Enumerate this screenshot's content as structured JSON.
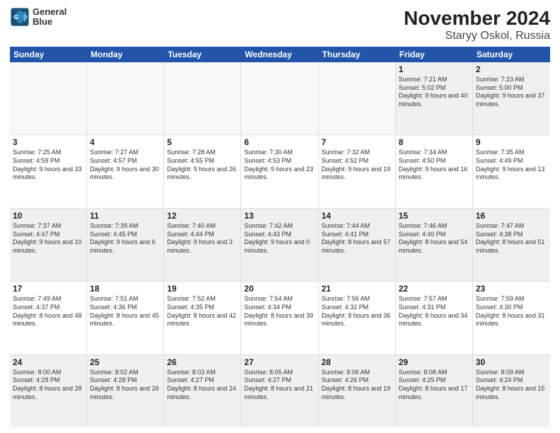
{
  "header": {
    "logo_line1": "General",
    "logo_line2": "Blue",
    "title": "November 2024",
    "subtitle": "Staryy Oskol, Russia"
  },
  "weekdays": [
    "Sunday",
    "Monday",
    "Tuesday",
    "Wednesday",
    "Thursday",
    "Friday",
    "Saturday"
  ],
  "rows": [
    [
      {
        "day": "",
        "info": ""
      },
      {
        "day": "",
        "info": ""
      },
      {
        "day": "",
        "info": ""
      },
      {
        "day": "",
        "info": ""
      },
      {
        "day": "",
        "info": ""
      },
      {
        "day": "1",
        "info": "Sunrise: 7:21 AM\nSunset: 5:02 PM\nDaylight: 9 hours and 40 minutes."
      },
      {
        "day": "2",
        "info": "Sunrise: 7:23 AM\nSunset: 5:00 PM\nDaylight: 9 hours and 37 minutes."
      }
    ],
    [
      {
        "day": "3",
        "info": "Sunrise: 7:25 AM\nSunset: 4:59 PM\nDaylight: 9 hours and 33 minutes."
      },
      {
        "day": "4",
        "info": "Sunrise: 7:27 AM\nSunset: 4:57 PM\nDaylight: 9 hours and 30 minutes."
      },
      {
        "day": "5",
        "info": "Sunrise: 7:28 AM\nSunset: 4:55 PM\nDaylight: 9 hours and 26 minutes."
      },
      {
        "day": "6",
        "info": "Sunrise: 7:30 AM\nSunset: 4:53 PM\nDaylight: 9 hours and 23 minutes."
      },
      {
        "day": "7",
        "info": "Sunrise: 7:32 AM\nSunset: 4:52 PM\nDaylight: 9 hours and 19 minutes."
      },
      {
        "day": "8",
        "info": "Sunrise: 7:34 AM\nSunset: 4:50 PM\nDaylight: 9 hours and 16 minutes."
      },
      {
        "day": "9",
        "info": "Sunrise: 7:35 AM\nSunset: 4:49 PM\nDaylight: 9 hours and 13 minutes."
      }
    ],
    [
      {
        "day": "10",
        "info": "Sunrise: 7:37 AM\nSunset: 4:47 PM\nDaylight: 9 hours and 10 minutes."
      },
      {
        "day": "11",
        "info": "Sunrise: 7:39 AM\nSunset: 4:45 PM\nDaylight: 9 hours and 6 minutes."
      },
      {
        "day": "12",
        "info": "Sunrise: 7:40 AM\nSunset: 4:44 PM\nDaylight: 9 hours and 3 minutes."
      },
      {
        "day": "13",
        "info": "Sunrise: 7:42 AM\nSunset: 4:43 PM\nDaylight: 9 hours and 0 minutes."
      },
      {
        "day": "14",
        "info": "Sunrise: 7:44 AM\nSunset: 4:41 PM\nDaylight: 8 hours and 57 minutes."
      },
      {
        "day": "15",
        "info": "Sunrise: 7:46 AM\nSunset: 4:40 PM\nDaylight: 8 hours and 54 minutes."
      },
      {
        "day": "16",
        "info": "Sunrise: 7:47 AM\nSunset: 4:38 PM\nDaylight: 8 hours and 51 minutes."
      }
    ],
    [
      {
        "day": "17",
        "info": "Sunrise: 7:49 AM\nSunset: 4:37 PM\nDaylight: 8 hours and 48 minutes."
      },
      {
        "day": "18",
        "info": "Sunrise: 7:51 AM\nSunset: 4:36 PM\nDaylight: 8 hours and 45 minutes."
      },
      {
        "day": "19",
        "info": "Sunrise: 7:52 AM\nSunset: 4:35 PM\nDaylight: 8 hours and 42 minutes."
      },
      {
        "day": "20",
        "info": "Sunrise: 7:54 AM\nSunset: 4:34 PM\nDaylight: 8 hours and 39 minutes."
      },
      {
        "day": "21",
        "info": "Sunrise: 7:56 AM\nSunset: 4:32 PM\nDaylight: 8 hours and 36 minutes."
      },
      {
        "day": "22",
        "info": "Sunrise: 7:57 AM\nSunset: 4:31 PM\nDaylight: 8 hours and 34 minutes."
      },
      {
        "day": "23",
        "info": "Sunrise: 7:59 AM\nSunset: 4:30 PM\nDaylight: 8 hours and 31 minutes."
      }
    ],
    [
      {
        "day": "24",
        "info": "Sunrise: 8:00 AM\nSunset: 4:29 PM\nDaylight: 8 hours and 28 minutes."
      },
      {
        "day": "25",
        "info": "Sunrise: 8:02 AM\nSunset: 4:28 PM\nDaylight: 8 hours and 26 minutes."
      },
      {
        "day": "26",
        "info": "Sunrise: 8:03 AM\nSunset: 4:27 PM\nDaylight: 8 hours and 24 minutes."
      },
      {
        "day": "27",
        "info": "Sunrise: 8:05 AM\nSunset: 4:27 PM\nDaylight: 8 hours and 21 minutes."
      },
      {
        "day": "28",
        "info": "Sunrise: 8:06 AM\nSunset: 4:26 PM\nDaylight: 8 hours and 19 minutes."
      },
      {
        "day": "29",
        "info": "Sunrise: 8:08 AM\nSunset: 4:25 PM\nDaylight: 8 hours and 17 minutes."
      },
      {
        "day": "30",
        "info": "Sunrise: 8:09 AM\nSunset: 4:24 PM\nDaylight: 8 hours and 15 minutes."
      }
    ]
  ]
}
